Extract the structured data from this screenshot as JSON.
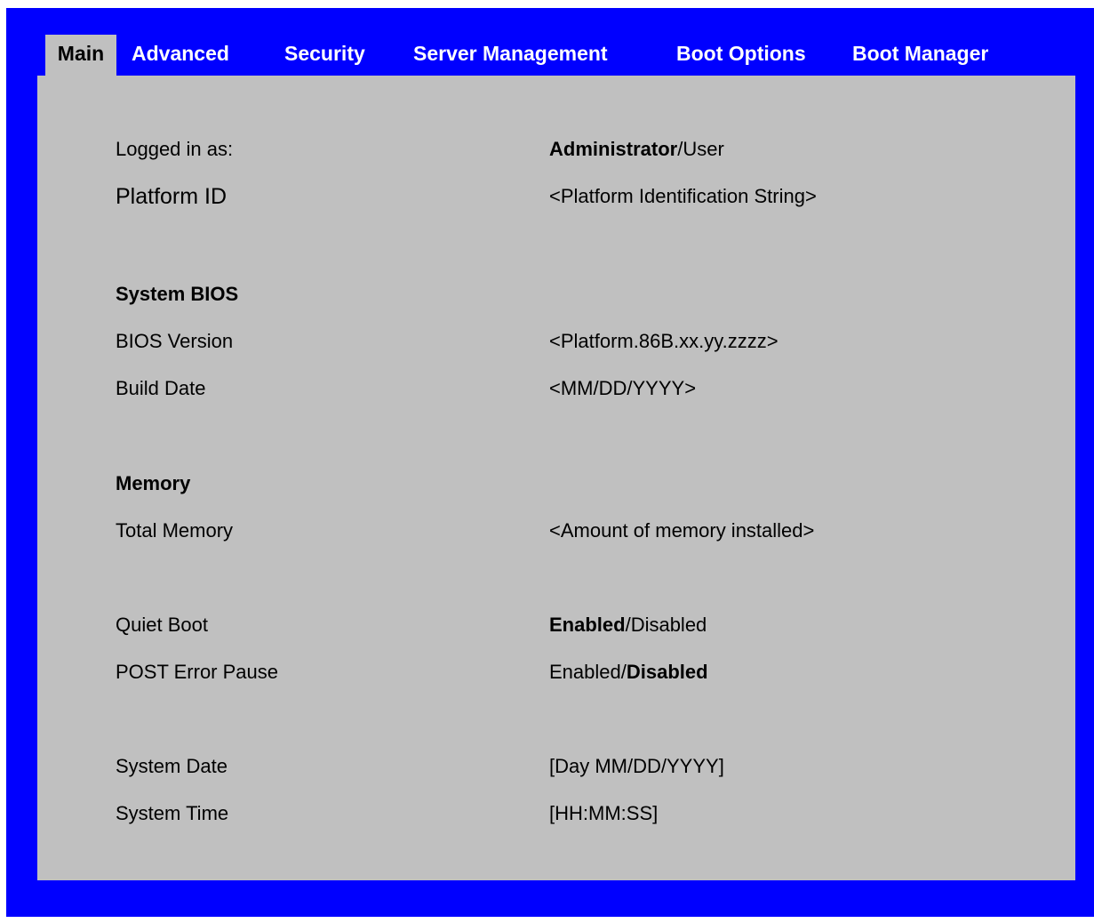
{
  "tabs": {
    "main": "Main",
    "advanced": "Advanced",
    "security": "Security",
    "server_management": "Server Management",
    "boot_options": "Boot Options",
    "boot_manager": "Boot Manager"
  },
  "rows": {
    "logged_in": {
      "label": "Logged in as:",
      "value_bold": "Administrator",
      "value_rest": "/User"
    },
    "platform_id": {
      "label": "Platform ID",
      "value": "<Platform Identification String>"
    },
    "system_bios_header": "System BIOS",
    "bios_version": {
      "label": "BIOS Version",
      "value": "<Platform.86B.xx.yy.zzzz>"
    },
    "build_date": {
      "label": "Build Date",
      "value": "<MM/DD/YYYY>"
    },
    "memory_header": "Memory",
    "total_memory": {
      "label": "Total Memory",
      "value": "<Amount of memory installed>"
    },
    "quiet_boot": {
      "label": "Quiet Boot",
      "value_bold": "Enabled",
      "value_rest": "/Disabled"
    },
    "post_error_pause": {
      "label": "POST Error Pause",
      "value_prefix": "Enabled/",
      "value_bold": "Disabled"
    },
    "system_date": {
      "label": "System Date",
      "value": "[Day MM/DD/YYYY]"
    },
    "system_time": {
      "label": "System Time",
      "value": "[HH:MM:SS]"
    }
  },
  "colors": {
    "frame": "#0000ff",
    "panel": "#c0c0c0",
    "tab_text": "#ffffff"
  }
}
